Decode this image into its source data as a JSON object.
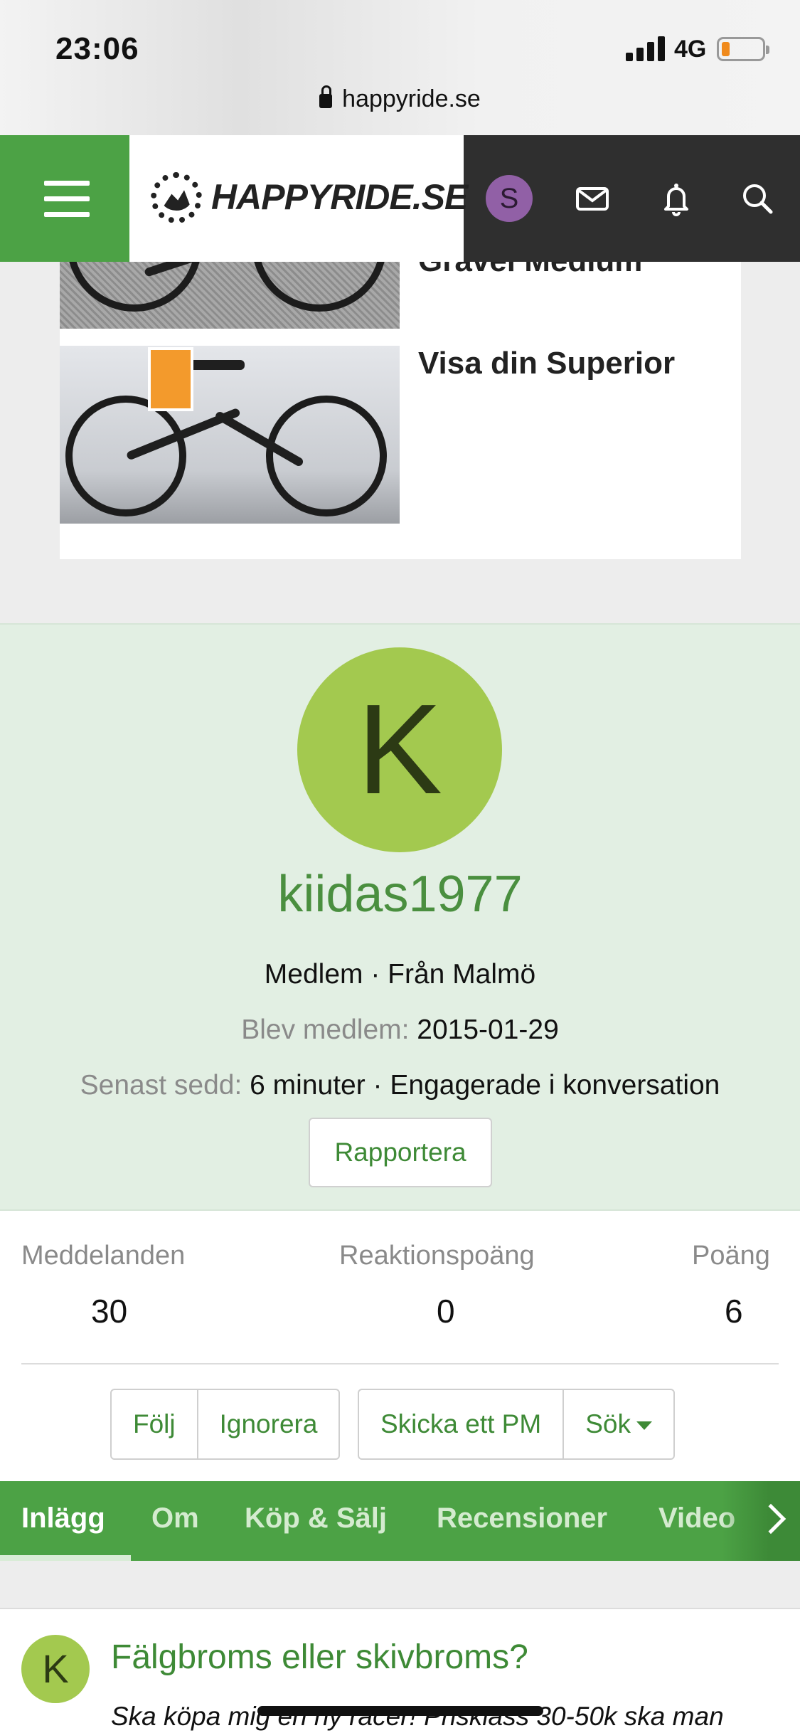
{
  "status_bar": {
    "time": "23:06",
    "network": "4G",
    "url": "happyride.se"
  },
  "header": {
    "site_name": "HAPPYRIDE.SE",
    "user_initial": "S"
  },
  "cards": [
    {
      "title": "Gravel Medium"
    },
    {
      "title": "Visa din Superior"
    }
  ],
  "profile": {
    "avatar_letter": "K",
    "username": "kiidas1977",
    "role": "Medlem",
    "separator": " · ",
    "location": "Från Malmö",
    "joined_label": "Blev medlem:",
    "joined_value": "2015-01-29",
    "last_seen_label": "Senast sedd:",
    "last_seen_value": "6 minuter",
    "last_seen_activity": "Engagerade i konversation",
    "report_button": "Rapportera"
  },
  "stats": [
    {
      "label": "Meddelanden",
      "value": "30"
    },
    {
      "label": "Reaktionspoäng",
      "value": "0"
    },
    {
      "label": "Poäng",
      "value": "6"
    }
  ],
  "actions": {
    "follow": "Följ",
    "ignore": "Ignorera",
    "send_pm": "Skicka ett PM",
    "search": "Sök"
  },
  "tabs": [
    "Inlägg",
    "Om",
    "Köp & Sälj",
    "Recensioner",
    "Video"
  ],
  "active_tab": "Inlägg",
  "post": {
    "avatar_letter": "K",
    "title": "Fälgbroms eller skivbroms?",
    "snippet": "Ska köpa mig en ny racer! Prisklass 30-50k ska man"
  },
  "colors": {
    "brand_green": "#4ca245",
    "link_green": "#3e8a36",
    "avatar_green": "#a3c94f",
    "header_dark": "#2f2f2f",
    "user_avatar_purple": "#9160a6",
    "profile_bg": "#e2efe3"
  },
  "icons": [
    "lock-icon",
    "menu-icon",
    "site-logo-icon",
    "mail-icon",
    "bell-icon",
    "search-icon",
    "chevron-right-icon",
    "caret-down-icon"
  ]
}
